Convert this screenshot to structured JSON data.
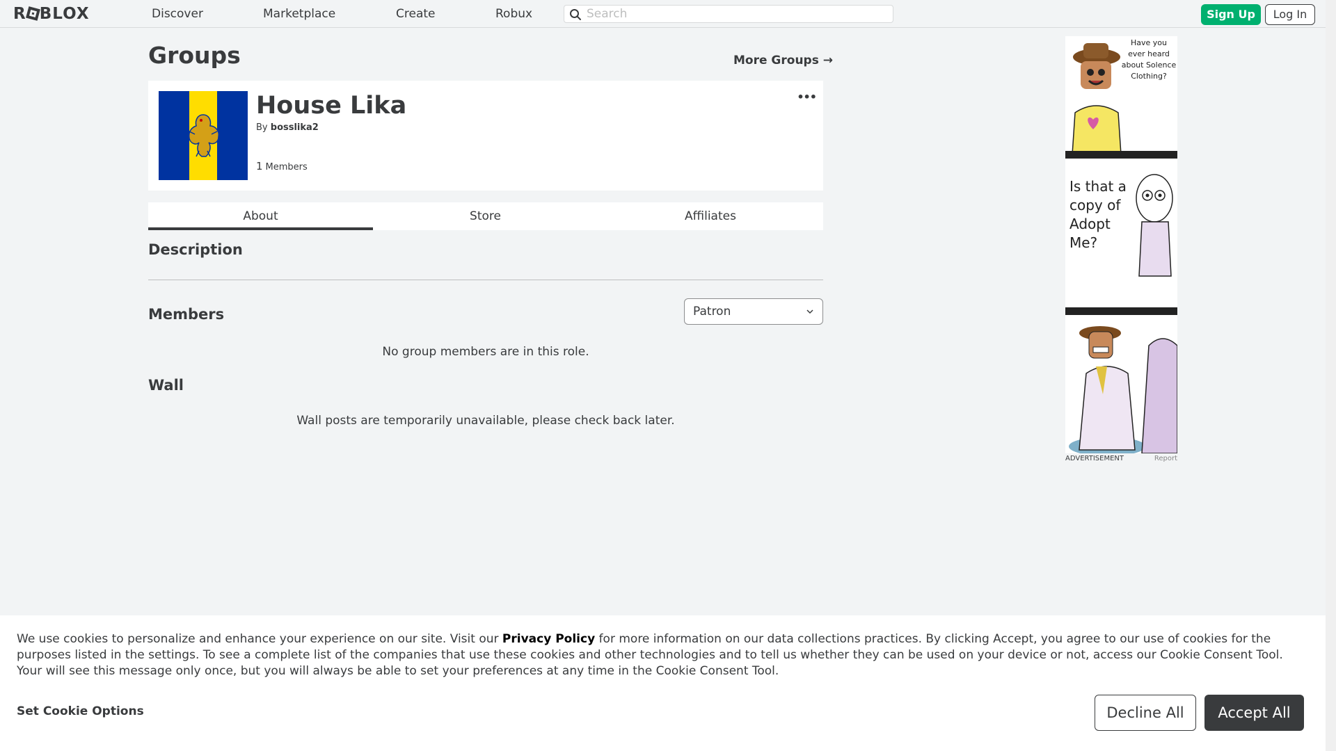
{
  "header": {
    "logo": "ROBLOX",
    "nav": [
      "Discover",
      "Marketplace",
      "Create",
      "Robux"
    ],
    "search_placeholder": "Search",
    "signup_label": "Sign Up",
    "login_label": "Log In"
  },
  "page": {
    "title": "Groups",
    "more_groups": "More Groups →"
  },
  "group": {
    "name": "House Lika",
    "by_prefix": "By",
    "owner": "bosslika2",
    "member_count": "1",
    "members_label": "Members",
    "more_icon": "more-dots-icon"
  },
  "tabs": [
    {
      "label": "About",
      "active": true
    },
    {
      "label": "Store",
      "active": false
    },
    {
      "label": "Affiliates",
      "active": false
    }
  ],
  "about": {
    "description_heading": "Description",
    "members_heading": "Members",
    "role_selected": "Patron",
    "no_members_msg": "No group members are in this role.",
    "wall_heading": "Wall",
    "wall_msg": "Wall posts are temporarily unavailable, please check back later."
  },
  "ad": {
    "panel1_text": "Have you ever heard about Solence Clothing?",
    "panel2_text": "Is that a copy of Adopt Me?",
    "label": "ADVERTISEMENT",
    "report": "Report"
  },
  "cookie": {
    "text_before": "We use cookies to personalize and enhance your experience on our site. Visit our ",
    "privacy_link": "Privacy Policy",
    "text_after": " for more information on our data collections practices. By clicking Accept, you agree to our use of cookies for the purposes listed in the settings. To see a complete list of the companies that use these cookies and other technologies and to tell us whether they can be used on your device or not, access our Cookie Consent Tool. Your will see this message only once, but you will always be able to set your preferences at any time in the Cookie Consent Tool.",
    "set_options": "Set Cookie Options",
    "decline": "Decline All",
    "accept": "Accept All"
  },
  "colors": {
    "signup_green": "#00b06f",
    "emblem_blue": "#0033a0",
    "emblem_yellow": "#ffdd00",
    "dark": "#393b3d"
  }
}
